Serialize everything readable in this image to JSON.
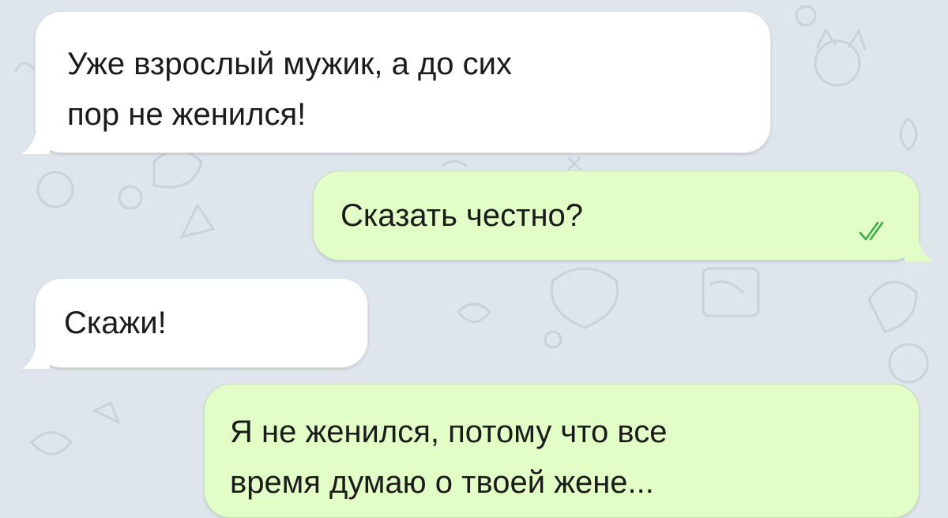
{
  "messages": [
    {
      "direction": "incoming",
      "text": "Уже взрослый мужик, а до сих\nпор не женился!"
    },
    {
      "direction": "outgoing",
      "text": "Сказать честно?",
      "status": "read-double-check"
    },
    {
      "direction": "incoming",
      "text": "Скажи!"
    },
    {
      "direction": "outgoing",
      "text": "Я не женился, потому что все\nвремя думаю о твоей жене..."
    }
  ],
  "colors": {
    "background": "#dfe5ec",
    "incoming_bubble": "#ffffff",
    "outgoing_bubble": "#e2fec6",
    "text": "#1b1b1b",
    "read_checks": "#3cb043"
  }
}
